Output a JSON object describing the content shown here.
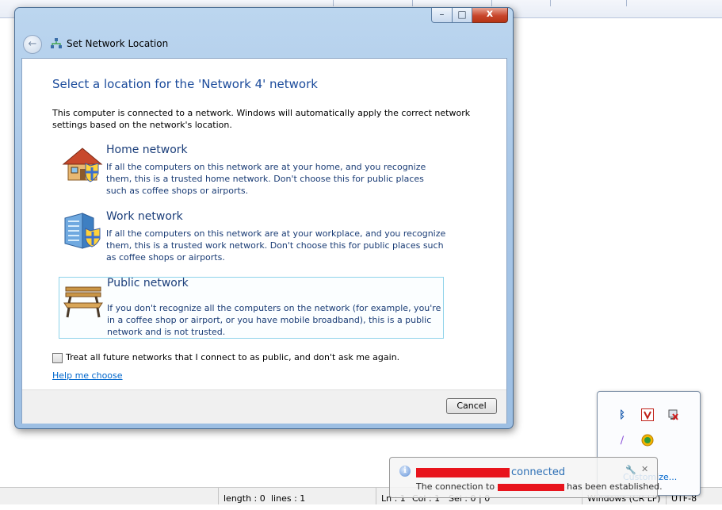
{
  "dialog": {
    "title": "Set Network Location",
    "caption_buttons": {
      "minimize": "–",
      "maximize": "□",
      "close": "x"
    },
    "main_instruction": "Select a location for the 'Network  4' network",
    "intro": "This computer is connected to a network. Windows will automatically apply the correct network settings based on the network's location.",
    "options": [
      {
        "title": "Home network",
        "description": "If all the computers on this network are at your home, and you recognize them, this is a trusted home network.  Don't choose this for public places such as coffee shops or airports.",
        "icon": "house-icon"
      },
      {
        "title": "Work network",
        "description": "If all the computers on this network are at your workplace, and you recognize them, this is a trusted work network.  Don't choose this for public places such as coffee shops or airports.",
        "icon": "office-building-icon"
      },
      {
        "title": "Public network",
        "description": "If you don't recognize all the computers on the network (for example, you're in a coffee shop or airport, or you have mobile broadband), this is a public network and is not trusted.",
        "icon": "park-bench-icon",
        "selected": true
      }
    ],
    "checkbox_label": "Treat all future networks that I connect to as public, and don't ask me again.",
    "checkbox_checked": false,
    "help_link": "Help me choose",
    "cancel_label": "Cancel"
  },
  "statusbar": {
    "length": "length : 0",
    "lines": "lines : 1",
    "ln": "Ln : 1",
    "col": "Col : 1",
    "sel": "Sel : 0 | 0",
    "eol": "Windows (CR LF)",
    "extra": "UTF-8"
  },
  "tray": {
    "icons": [
      "bluetooth-icon",
      "antivirus-icon",
      "network-warning-icon",
      "pen-tablet-icon",
      "update-icon"
    ],
    "customize": "Customize..."
  },
  "balloon": {
    "title": "connected",
    "body_prefix": "The connection to",
    "body_suffix": "has been established."
  },
  "colors": {
    "instruction": "#1b4b9b",
    "link": "#0066cc",
    "selected_border": "#8fd3ea",
    "redaction": "#e8141c"
  }
}
